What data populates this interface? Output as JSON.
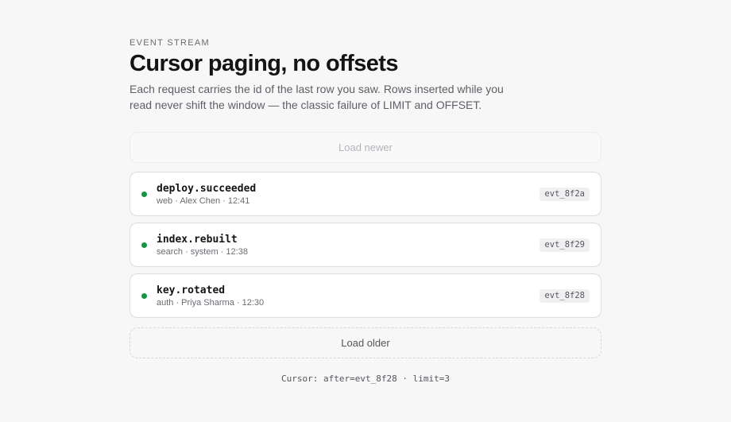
{
  "header": {
    "eyebrow": "EVENT STREAM",
    "title": "Cursor paging, no offsets",
    "description": "Each request carries the id of the last row you saw. Rows inserted while you read never shift the window — the classic failure of LIMIT and OFFSET."
  },
  "controls": {
    "load_newer": "Load newer",
    "load_older": "Load older"
  },
  "events": [
    {
      "name": "deploy.succeeded",
      "meta": "web · Alex Chen · 12:41",
      "id": "evt_8f2a",
      "status_color": "#149447"
    },
    {
      "name": "index.rebuilt",
      "meta": "search · system · 12:38",
      "id": "evt_8f29",
      "status_color": "#149447"
    },
    {
      "name": "key.rotated",
      "meta": "auth · Priya Sharma · 12:30",
      "id": "evt_8f28",
      "status_color": "#149447"
    }
  ],
  "footer": {
    "cursor_text": "Cursor: after=evt_8f28 · limit=3"
  }
}
